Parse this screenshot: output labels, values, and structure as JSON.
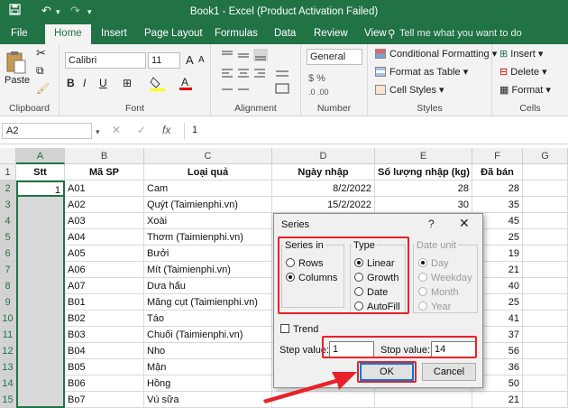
{
  "window": {
    "title": "Book1 - Excel (Product Activation Failed)",
    "save_icon": "save-icon",
    "undo_icon": "undo-icon",
    "redo_icon": "redo-icon"
  },
  "ribbon_tabs": [
    "File",
    "Home",
    "Insert",
    "Page Layout",
    "Formulas",
    "Data",
    "Review",
    "View"
  ],
  "active_tab": "Home",
  "tell_me": "Tell me what you want to do",
  "ribbon": {
    "clipboard": {
      "paste": "Paste",
      "label": "Clipboard"
    },
    "font": {
      "name": "Calibri",
      "size": "11",
      "bold": "B",
      "italic": "I",
      "underline": "U",
      "label": "Font",
      "grow": "A",
      "shrink": "A"
    },
    "alignment": {
      "label": "Alignment"
    },
    "number": {
      "format": "General",
      "label": "Number"
    },
    "styles": {
      "conditional": "Conditional Formatting",
      "table": "Format as Table",
      "cell_styles": "Cell Styles",
      "label": "Styles"
    },
    "cells": {
      "insert": "Insert",
      "delete": "Delete",
      "format": "Format",
      "label": "Cells"
    }
  },
  "formula_bar": {
    "name_box": "A2",
    "fx": "fx",
    "cancel": "✕",
    "enter": "✓",
    "value": "1"
  },
  "columns": [
    "A",
    "B",
    "C",
    "D",
    "E",
    "F",
    "G"
  ],
  "rows": [
    "1",
    "2",
    "3",
    "4",
    "5",
    "6",
    "7",
    "8",
    "9",
    "10",
    "11",
    "12",
    "13",
    "14",
    "15"
  ],
  "headers": [
    "Stt",
    "Mã SP",
    "Loại quả",
    "Ngày nhập",
    "Số lượng nhập (kg)",
    "Đã bán"
  ],
  "table": [
    [
      "1",
      "A01",
      "Cam",
      "8/2/2022",
      "28",
      "28"
    ],
    [
      "",
      "A02",
      "Quýt (Taimienphi.vn)",
      "15/2/2022",
      "30",
      "35"
    ],
    [
      "",
      "A03",
      "Xoài",
      "",
      "",
      "45"
    ],
    [
      "",
      "A04",
      "Thơm (Taimienphi.vn)",
      "",
      "",
      "25"
    ],
    [
      "",
      "A05",
      "Bưởi",
      "",
      "",
      "19"
    ],
    [
      "",
      "A06",
      "Mít (Taimienphi.vn)",
      "",
      "",
      "21"
    ],
    [
      "",
      "A07",
      "Dưa hấu",
      "",
      "",
      "40"
    ],
    [
      "",
      "B01",
      "Măng cụt (Taimienphi.vn)",
      "",
      "",
      "25"
    ],
    [
      "",
      "B02",
      "Táo",
      "",
      "",
      "41"
    ],
    [
      "",
      "B03",
      "Chuối (Taimienphi.vn)",
      "",
      "",
      "37"
    ],
    [
      "",
      "B04",
      "Nho",
      "",
      "",
      "56"
    ],
    [
      "",
      "B05",
      "Mận",
      "",
      "",
      "36"
    ],
    [
      "",
      "B06",
      "Hồng",
      "",
      "",
      "50"
    ],
    [
      "",
      "Bo7",
      "Vú sữa",
      "",
      "",
      "21"
    ]
  ],
  "dialog": {
    "title": "Series",
    "help": "?",
    "close": "✕",
    "series_in": {
      "label": "Series in",
      "rows": "Rows",
      "columns": "Columns",
      "selected": "Columns"
    },
    "type": {
      "label": "Type",
      "linear": "Linear",
      "growth": "Growth",
      "date": "Date",
      "autofill": "AutoFill",
      "selected": "Linear"
    },
    "date_unit": {
      "label": "Date unit",
      "day": "Day",
      "weekday": "Weekday",
      "month": "Month",
      "year": "Year"
    },
    "trend": "Trend",
    "step_label": "Step value:",
    "step_value": "1",
    "stop_label": "Stop value:",
    "stop_value": "14",
    "ok": "OK",
    "cancel": "Cancel"
  },
  "colors": {
    "excel_green": "#217346",
    "highlight_red": "#e8212a",
    "ok_border": "#0078d7"
  }
}
